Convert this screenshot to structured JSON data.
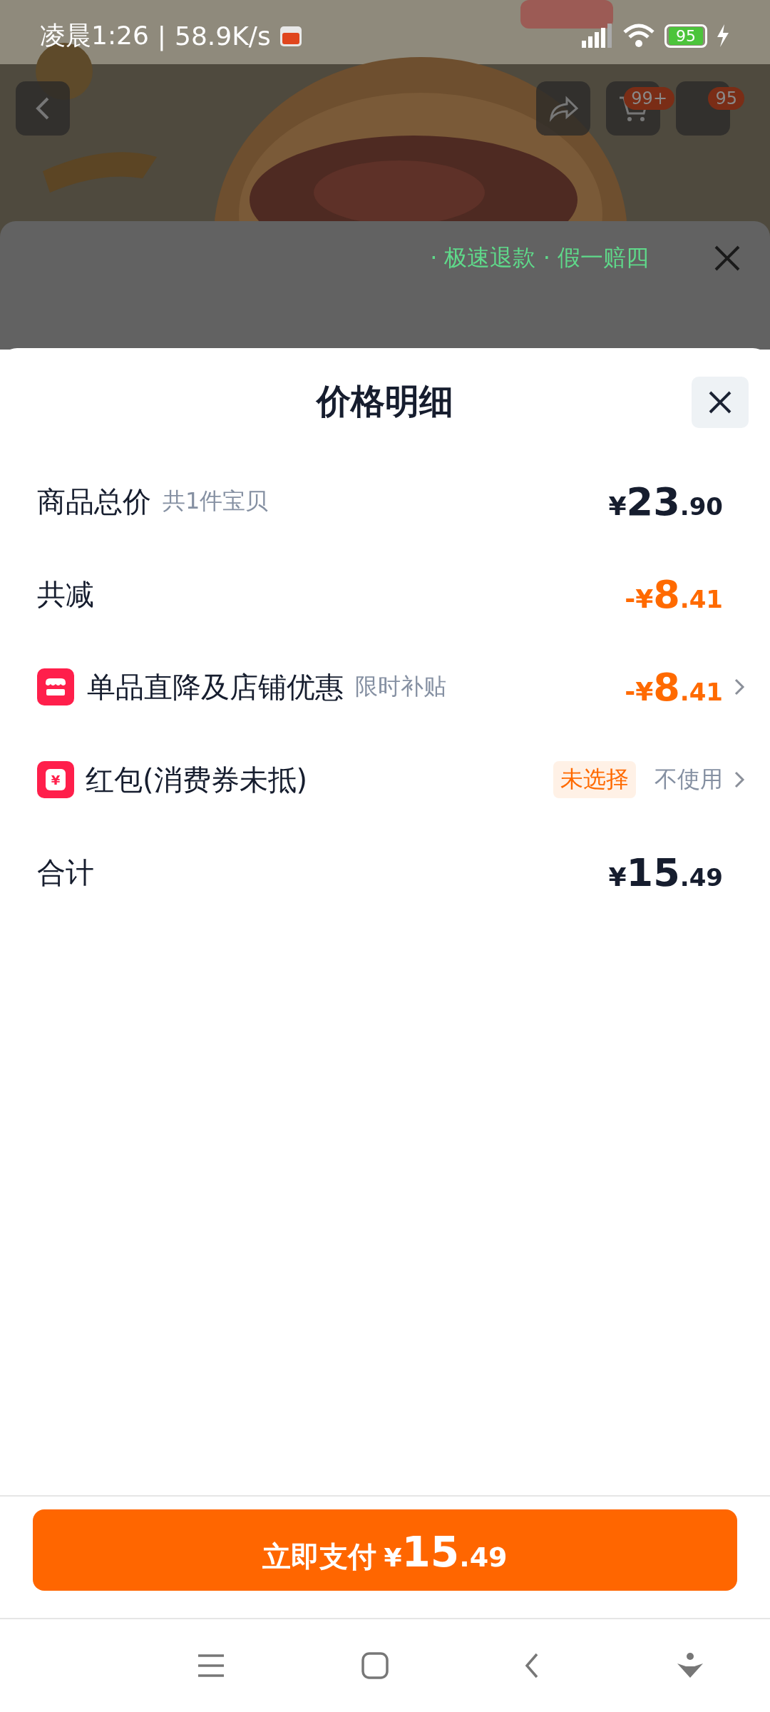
{
  "status_bar": {
    "time": "凌晨1:26",
    "separator": "|",
    "speed": "58.9K/s",
    "battery": "95"
  },
  "header": {
    "cart_badge": "99+",
    "message_badge": "95"
  },
  "background_sheet": {
    "notice": "· 极速退款 · 假一赔四"
  },
  "sheet": {
    "title": "价格明细",
    "rows": [
      {
        "kind": "plain",
        "label": "商品总价",
        "note": "共1件宝贝",
        "discount": false,
        "amount": {
          "prefix": "¥",
          "integer": "23",
          "decimal": ".90"
        },
        "chevron": false
      },
      {
        "kind": "plain",
        "label": "共减",
        "discount": true,
        "amount": {
          "prefix": "-¥",
          "integer": "8",
          "decimal": ".41"
        },
        "chevron": false
      },
      {
        "kind": "shop",
        "label": "单品直降及店铺优惠",
        "note": "限时补贴",
        "discount": true,
        "amount": {
          "prefix": "-¥",
          "integer": "8",
          "decimal": ".41"
        },
        "chevron": true
      },
      {
        "kind": "coupon",
        "icon_glyph": "¥",
        "label": "红包(消费券未抵)",
        "tag": "未选择",
        "value": "不使用",
        "chevron": true
      },
      {
        "kind": "plain",
        "label": "合计",
        "discount": false,
        "amount": {
          "prefix": "¥",
          "integer": "15",
          "decimal": ".49"
        },
        "chevron": false
      }
    ]
  },
  "pay_button": {
    "label": "立即支付",
    "prefix": "¥",
    "integer": "15",
    "decimal": ".49"
  }
}
